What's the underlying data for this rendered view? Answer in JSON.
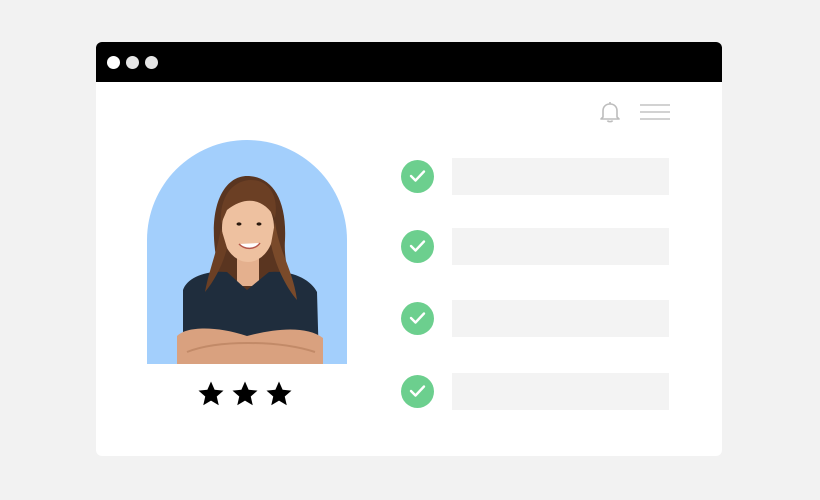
{
  "window": {
    "traffic_lights": [
      "close",
      "minimize",
      "maximize"
    ]
  },
  "header": {
    "icons": [
      "bell-icon",
      "hamburger-menu-icon"
    ]
  },
  "profile": {
    "rating": 3,
    "rating_max": 3,
    "arch_color": "#a3cffc"
  },
  "checklist": {
    "items": [
      {
        "checked": true,
        "text": ""
      },
      {
        "checked": true,
        "text": ""
      },
      {
        "checked": true,
        "text": ""
      },
      {
        "checked": true,
        "text": ""
      }
    ],
    "check_color": "#6ccf8e"
  }
}
